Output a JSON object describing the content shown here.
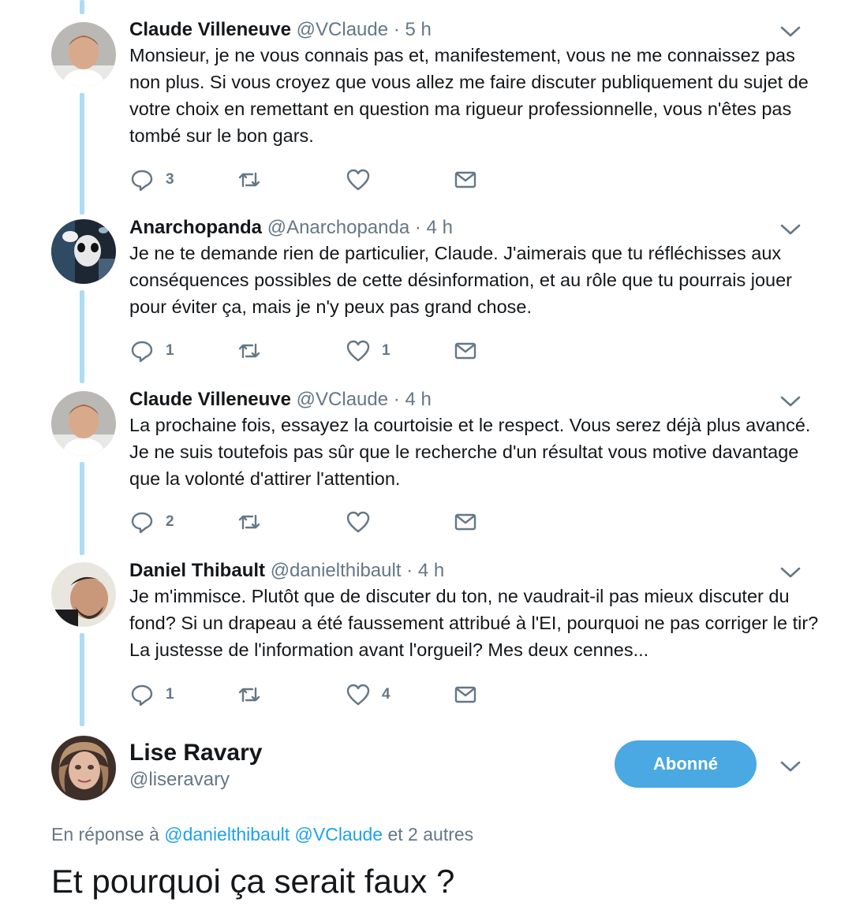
{
  "tweets": [
    {
      "name": "Claude Villeneuve",
      "handle": "@VClaude",
      "dot": "·",
      "time": "5 h",
      "text": "Monsieur, je ne vous connais pas et, manifestement, vous ne me connaissez pas non plus. Si vous croyez que vous allez me faire discuter publiquement du sujet de votre choix en remettant en question ma rigueur professionnelle, vous n'êtes pas tombé sur le bon gars.",
      "replies": "3",
      "retweets": "",
      "likes": ""
    },
    {
      "name": "Anarchopanda",
      "handle": "@Anarchopanda",
      "dot": "·",
      "time": "4 h",
      "text": "Je ne te demande rien de particulier, Claude. J'aimerais que tu réfléchisses aux conséquences possibles de cette désinformation, et au rôle que tu pourrais jouer pour éviter ça, mais je n'y peux pas grand chose.",
      "replies": "1",
      "retweets": "",
      "likes": "1"
    },
    {
      "name": "Claude Villeneuve",
      "handle": "@VClaude",
      "dot": "·",
      "time": "4 h",
      "text": "La prochaine fois, essayez la courtoisie et le respect. Vous serez déjà plus avancé. Je ne suis toutefois pas sûr que le recherche d'un résultat vous motive davantage que la volonté d'attirer l'attention.",
      "replies": "2",
      "retweets": "",
      "likes": ""
    },
    {
      "name": "Daniel Thibault",
      "handle": "@danielthibault",
      "dot": "·",
      "time": "4 h",
      "text": "Je m'immisce. Plutôt que de discuter du ton, ne vaudrait-il pas mieux discuter du fond? Si un drapeau a été faussement attribué à l'EI, pourquoi ne pas corriger le tir? La justesse de l'information avant l'orgueil? Mes deux cennes...",
      "replies": "1",
      "retweets": "",
      "likes": "4"
    }
  ],
  "main_tweet": {
    "name": "Lise Ravary",
    "handle": "@liseravary",
    "follow_label": "Abonné",
    "reply_prefix": "En réponse à",
    "reply_mention_1": "@danielthibault",
    "reply_mention_2": "@VClaude",
    "reply_suffix": "et 2 autres",
    "text": "Et pourquoi ça serait faux ?"
  },
  "colors": {
    "thread_line": "#aedcf2",
    "accent": "#1da1f2",
    "follow_button": "#4aa8e3",
    "muted_text": "#657786"
  },
  "icons": {
    "reply": "reply-icon",
    "retweet": "retweet-icon",
    "like": "heart-icon",
    "dm": "envelope-icon",
    "menu": "chevron-down-icon"
  }
}
